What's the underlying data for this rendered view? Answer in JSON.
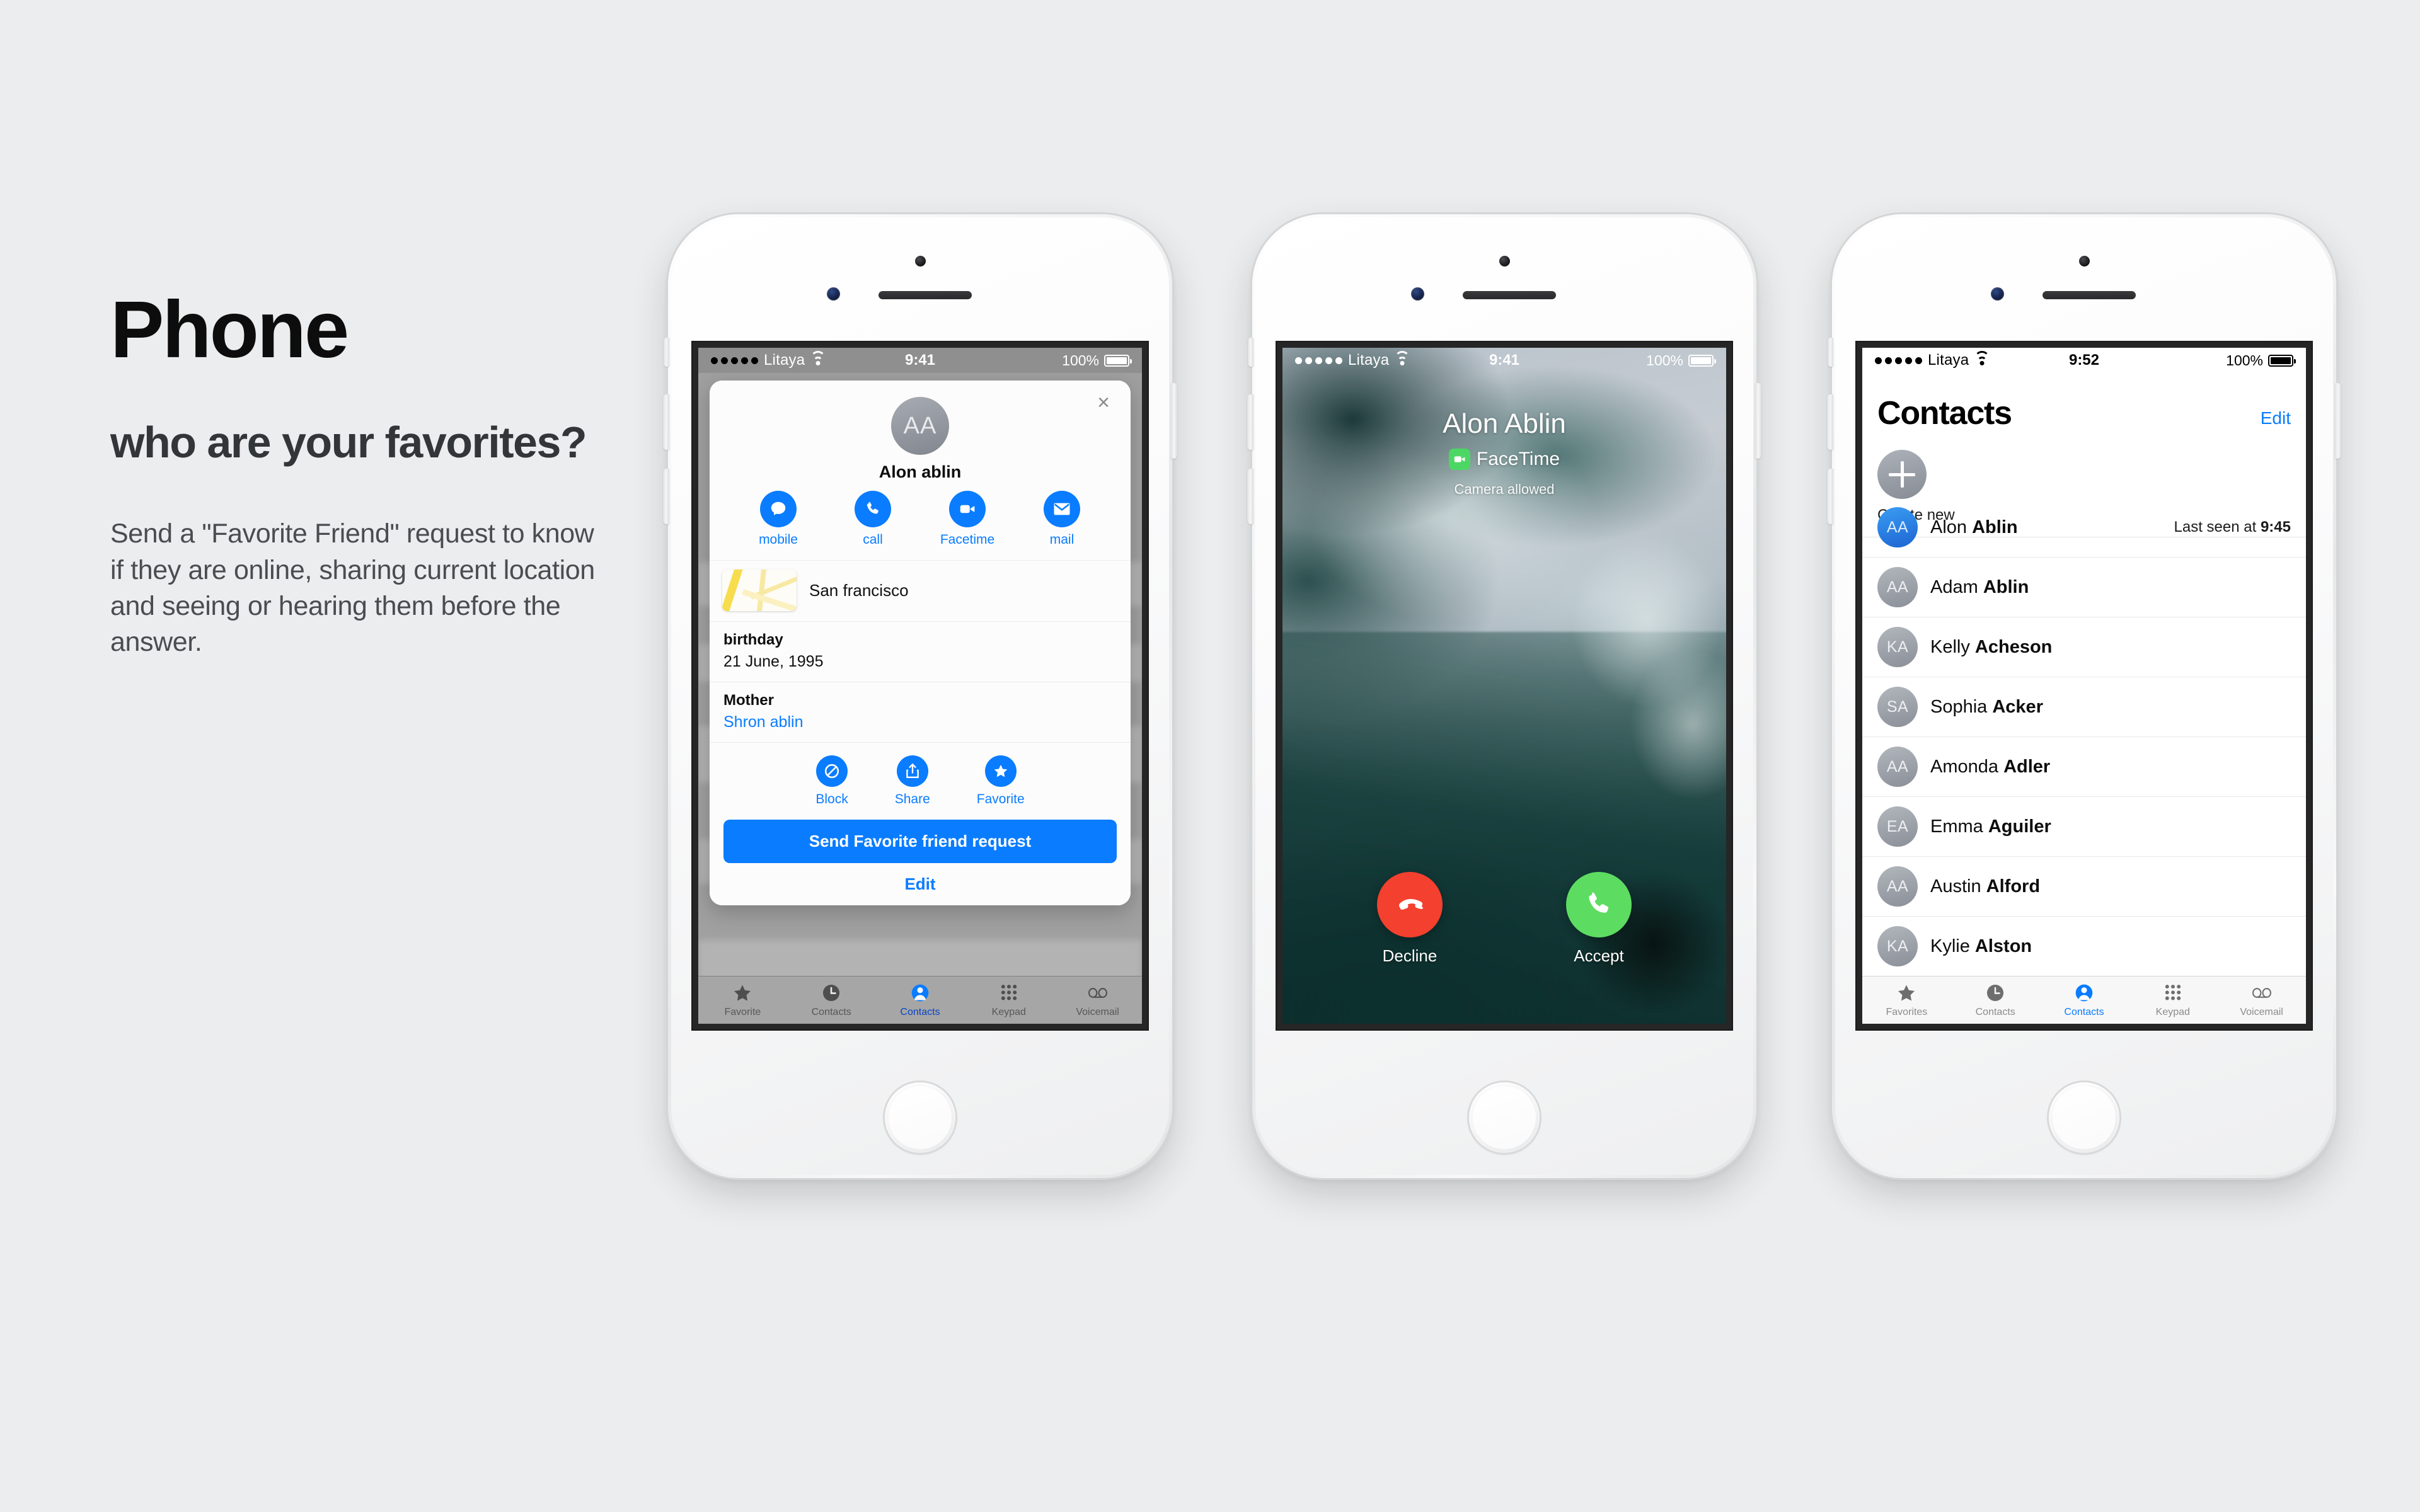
{
  "marketing": {
    "title": "Phone",
    "subtitle": "who are your favorites?",
    "body": "Send a \"Favorite Friend\" request to know if they are online, sharing current location and seeing or hearing them before the answer."
  },
  "colors": {
    "page_background": "#ecedee",
    "accent_blue": "#0a7cff",
    "decline_red": "#f4402e",
    "accept_green": "#5ddc62",
    "facetime_green": "#4cd764"
  },
  "phone1": {
    "status_bar": {
      "carrier": "Litaya",
      "time": "9:41",
      "battery": "100%"
    },
    "quick_card": {
      "avatar_initials": "AA",
      "name": "Alon ablin",
      "close_label": "×",
      "actions": [
        {
          "label": "mobile",
          "icon": "message-icon"
        },
        {
          "label": "call",
          "icon": "phone-icon"
        },
        {
          "label": "Facetime",
          "icon": "video-camera-icon"
        },
        {
          "label": "mail",
          "icon": "envelope-icon"
        }
      ],
      "address": "San francisco",
      "fields": [
        {
          "key": "birthday",
          "value": "21 June, 1995",
          "link": false
        },
        {
          "key": "Mother",
          "value": "Shron ablin",
          "link": true
        }
      ],
      "secondary_actions": [
        {
          "label": "Block",
          "icon": "block-icon"
        },
        {
          "label": "Share",
          "icon": "share-icon"
        },
        {
          "label": "Favorite",
          "icon": "star-icon"
        }
      ],
      "primary_button": "Send Favorite friend request",
      "edit_label": "Edit"
    },
    "tabs": [
      {
        "label": "Favorite",
        "icon": "star-icon",
        "active": false
      },
      {
        "label": "Contacts",
        "icon": "clock-icon",
        "active": false
      },
      {
        "label": "Contacts",
        "icon": "person-icon",
        "active": true
      },
      {
        "label": "Keypad",
        "icon": "keypad-icon",
        "active": false
      },
      {
        "label": "Voicemail",
        "icon": "voicemail-icon",
        "active": false
      }
    ]
  },
  "phone2": {
    "status_bar": {
      "carrier": "Litaya",
      "time": "9:41",
      "battery": "100%"
    },
    "caller_name": "Alon Ablin",
    "call_type": "FaceTime",
    "call_note": "Camera allowed",
    "buttons": [
      {
        "label": "Decline",
        "icon": "phone-down-icon",
        "color": "#f4402e"
      },
      {
        "label": "Accept",
        "icon": "phone-icon",
        "color": "#5ddc62"
      }
    ]
  },
  "phone3": {
    "status_bar": {
      "carrier": "Litaya",
      "time": "9:52",
      "battery": "100%"
    },
    "title": "Contacts",
    "edit_label": "Edit",
    "create_new_label": "Create new",
    "contacts": [
      {
        "initials": "AA",
        "first": "Alon ",
        "last": "Ablin",
        "meta_prefix": "Last seen at ",
        "meta_value": "9:45",
        "accent": true
      },
      {
        "initials": "AA",
        "first": "Adam ",
        "last": "Ablin",
        "meta_prefix": "",
        "meta_value": "",
        "accent": false
      },
      {
        "initials": "KA",
        "first": "Kelly ",
        "last": "Acheson",
        "meta_prefix": "",
        "meta_value": "",
        "accent": false
      },
      {
        "initials": "SA",
        "first": "Sophia ",
        "last": "Acker",
        "meta_prefix": "",
        "meta_value": "",
        "accent": false
      },
      {
        "initials": "AA",
        "first": "Amonda ",
        "last": "Adler",
        "meta_prefix": "",
        "meta_value": "",
        "accent": false
      },
      {
        "initials": "EA",
        "first": "Emma ",
        "last": "Aguiler",
        "meta_prefix": "",
        "meta_value": "",
        "accent": false
      },
      {
        "initials": "AA",
        "first": "Austin ",
        "last": "Alford",
        "meta_prefix": "",
        "meta_value": "",
        "accent": false
      },
      {
        "initials": "KA",
        "first": "Kylie ",
        "last": "Alston",
        "meta_prefix": "",
        "meta_value": "",
        "accent": false
      }
    ],
    "tabs": [
      {
        "label": "Favorites",
        "icon": "star-icon",
        "active": false
      },
      {
        "label": "Contacts",
        "icon": "clock-icon",
        "active": false
      },
      {
        "label": "Contacts",
        "icon": "person-icon",
        "active": true
      },
      {
        "label": "Keypad",
        "icon": "keypad-icon",
        "active": false
      },
      {
        "label": "Voicemail",
        "icon": "voicemail-icon",
        "active": false
      }
    ]
  }
}
